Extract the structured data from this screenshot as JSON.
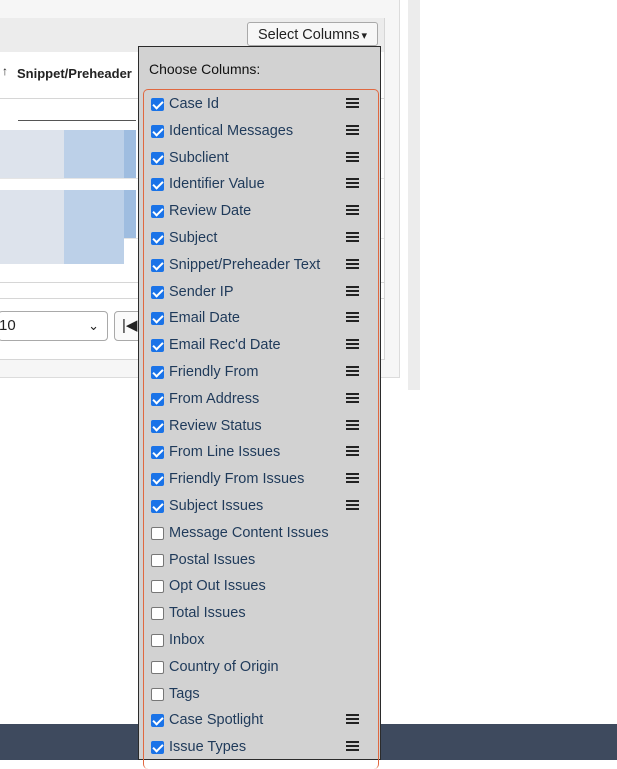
{
  "toolbar": {
    "select_columns_label": "Select Columns",
    "caret_glyph": "▾"
  },
  "table": {
    "visible_header": "Snippet/Preheader",
    "sort_glyph": "↑"
  },
  "pager": {
    "page_size": "10",
    "first_glyph": "|◀"
  },
  "dropdown": {
    "title": "Choose Columns:",
    "options": [
      {
        "label": "Case Id",
        "checked": true,
        "draggable": true
      },
      {
        "label": "Identical Messages",
        "checked": true,
        "draggable": true
      },
      {
        "label": "Subclient",
        "checked": true,
        "draggable": true
      },
      {
        "label": "Identifier Value",
        "checked": true,
        "draggable": true
      },
      {
        "label": "Review Date",
        "checked": true,
        "draggable": true
      },
      {
        "label": "Subject",
        "checked": true,
        "draggable": true
      },
      {
        "label": "Snippet/Preheader Text",
        "checked": true,
        "draggable": true
      },
      {
        "label": "Sender IP",
        "checked": true,
        "draggable": true
      },
      {
        "label": "Email Date",
        "checked": true,
        "draggable": true
      },
      {
        "label": "Email Rec'd Date",
        "checked": true,
        "draggable": true
      },
      {
        "label": "Friendly From",
        "checked": true,
        "draggable": true
      },
      {
        "label": "From Address",
        "checked": true,
        "draggable": true
      },
      {
        "label": "Review Status",
        "checked": true,
        "draggable": true
      },
      {
        "label": "From Line Issues",
        "checked": true,
        "draggable": true
      },
      {
        "label": "Friendly From Issues",
        "checked": true,
        "draggable": true
      },
      {
        "label": "Subject Issues",
        "checked": true,
        "draggable": true
      },
      {
        "label": "Message Content Issues",
        "checked": false,
        "draggable": false
      },
      {
        "label": "Postal Issues",
        "checked": false,
        "draggable": false
      },
      {
        "label": "Opt Out Issues",
        "checked": false,
        "draggable": false
      },
      {
        "label": "Total Issues",
        "checked": false,
        "draggable": false
      },
      {
        "label": "Inbox",
        "checked": false,
        "draggable": false
      },
      {
        "label": "Country of Origin",
        "checked": false,
        "draggable": false
      },
      {
        "label": "Tags",
        "checked": false,
        "draggable": false
      },
      {
        "label": "Case Spotlight",
        "checked": true,
        "draggable": true
      },
      {
        "label": "Issue Types",
        "checked": true,
        "draggable": true
      }
    ]
  },
  "colors": {
    "checkbox_checked": "#1a73e8",
    "dropdown_bg": "#d2d2d2",
    "list_border": "#e06840",
    "footer": "#3e4a5e",
    "row_highlight": "#bcd0e8"
  }
}
